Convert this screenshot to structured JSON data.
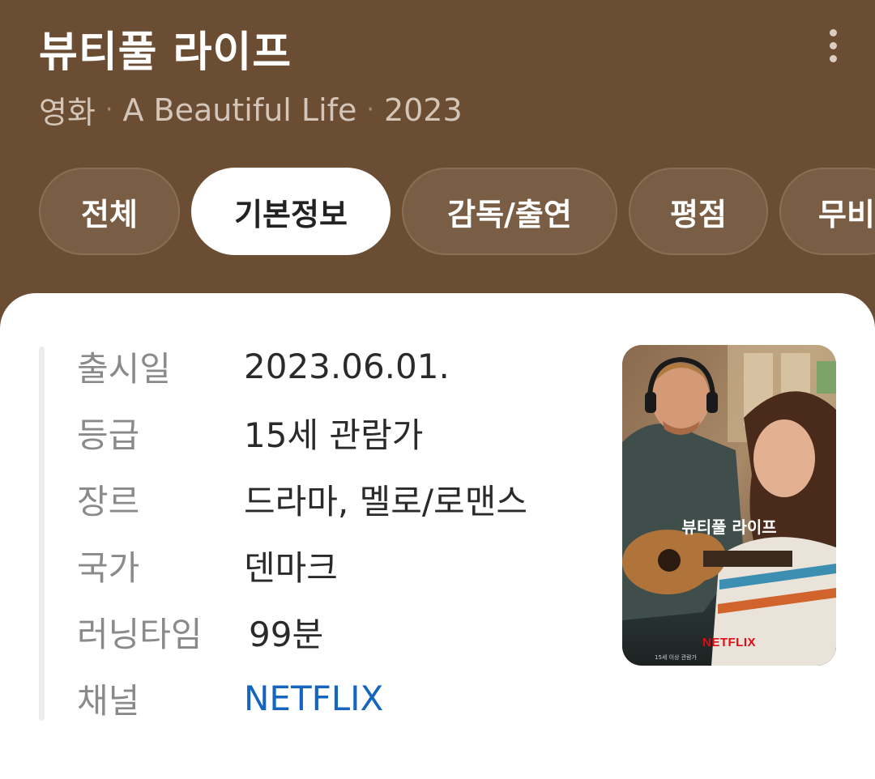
{
  "header": {
    "title": "뷰티풀 라이프",
    "subtitle": {
      "type": "영화",
      "original_title": "A Beautiful Life",
      "year": "2023",
      "separator": "·"
    },
    "more_icon": "more-vertical-icon"
  },
  "tabs": [
    {
      "label": "전체",
      "active": false
    },
    {
      "label": "기본정보",
      "active": true
    },
    {
      "label": "감독/출연",
      "active": false
    },
    {
      "label": "평점",
      "active": false
    },
    {
      "label": "무비",
      "active": false
    }
  ],
  "info": {
    "rows": [
      {
        "label": "출시일",
        "value": "2023.06.01."
      },
      {
        "label": "등급",
        "value": "15세 관람가"
      },
      {
        "label": "장르",
        "value": "드라마, 멜로/로맨스"
      },
      {
        "label": "국가",
        "value": "덴마크"
      },
      {
        "label": "러닝타임",
        "value": "99분"
      },
      {
        "label": "채널",
        "value": "NETFLIX"
      }
    ]
  },
  "poster": {
    "title_text": "뷰티풀 라이프",
    "brand": "NETFLIX",
    "rating_note": "15세 이상 관람가"
  },
  "colors": {
    "header_bg": "#6b4d33",
    "link": "#1565c0",
    "netflix_red": "#e50914"
  }
}
